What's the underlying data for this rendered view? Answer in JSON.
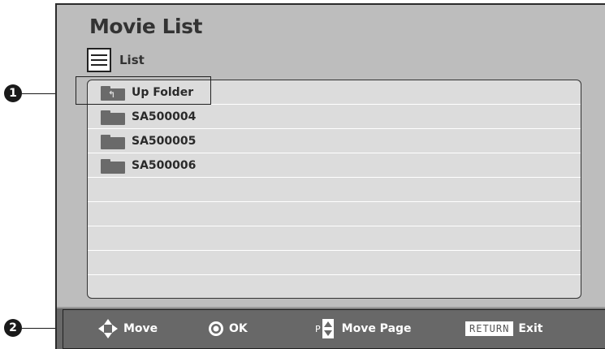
{
  "screen": {
    "title": "Movie List",
    "view_mode_label": "List"
  },
  "list": {
    "items": [
      {
        "label": "Up Folder",
        "icon": "up-folder-icon"
      },
      {
        "label": "SA500004",
        "icon": "folder-icon"
      },
      {
        "label": "SA500005",
        "icon": "folder-icon"
      },
      {
        "label": "SA500006",
        "icon": "folder-icon"
      }
    ]
  },
  "footer": {
    "move": "Move",
    "ok": "OK",
    "page_prefix": "P",
    "move_page": "Move Page",
    "return_key": "RETURN",
    "exit": "Exit"
  },
  "callouts": {
    "one": "1",
    "two": "2"
  }
}
